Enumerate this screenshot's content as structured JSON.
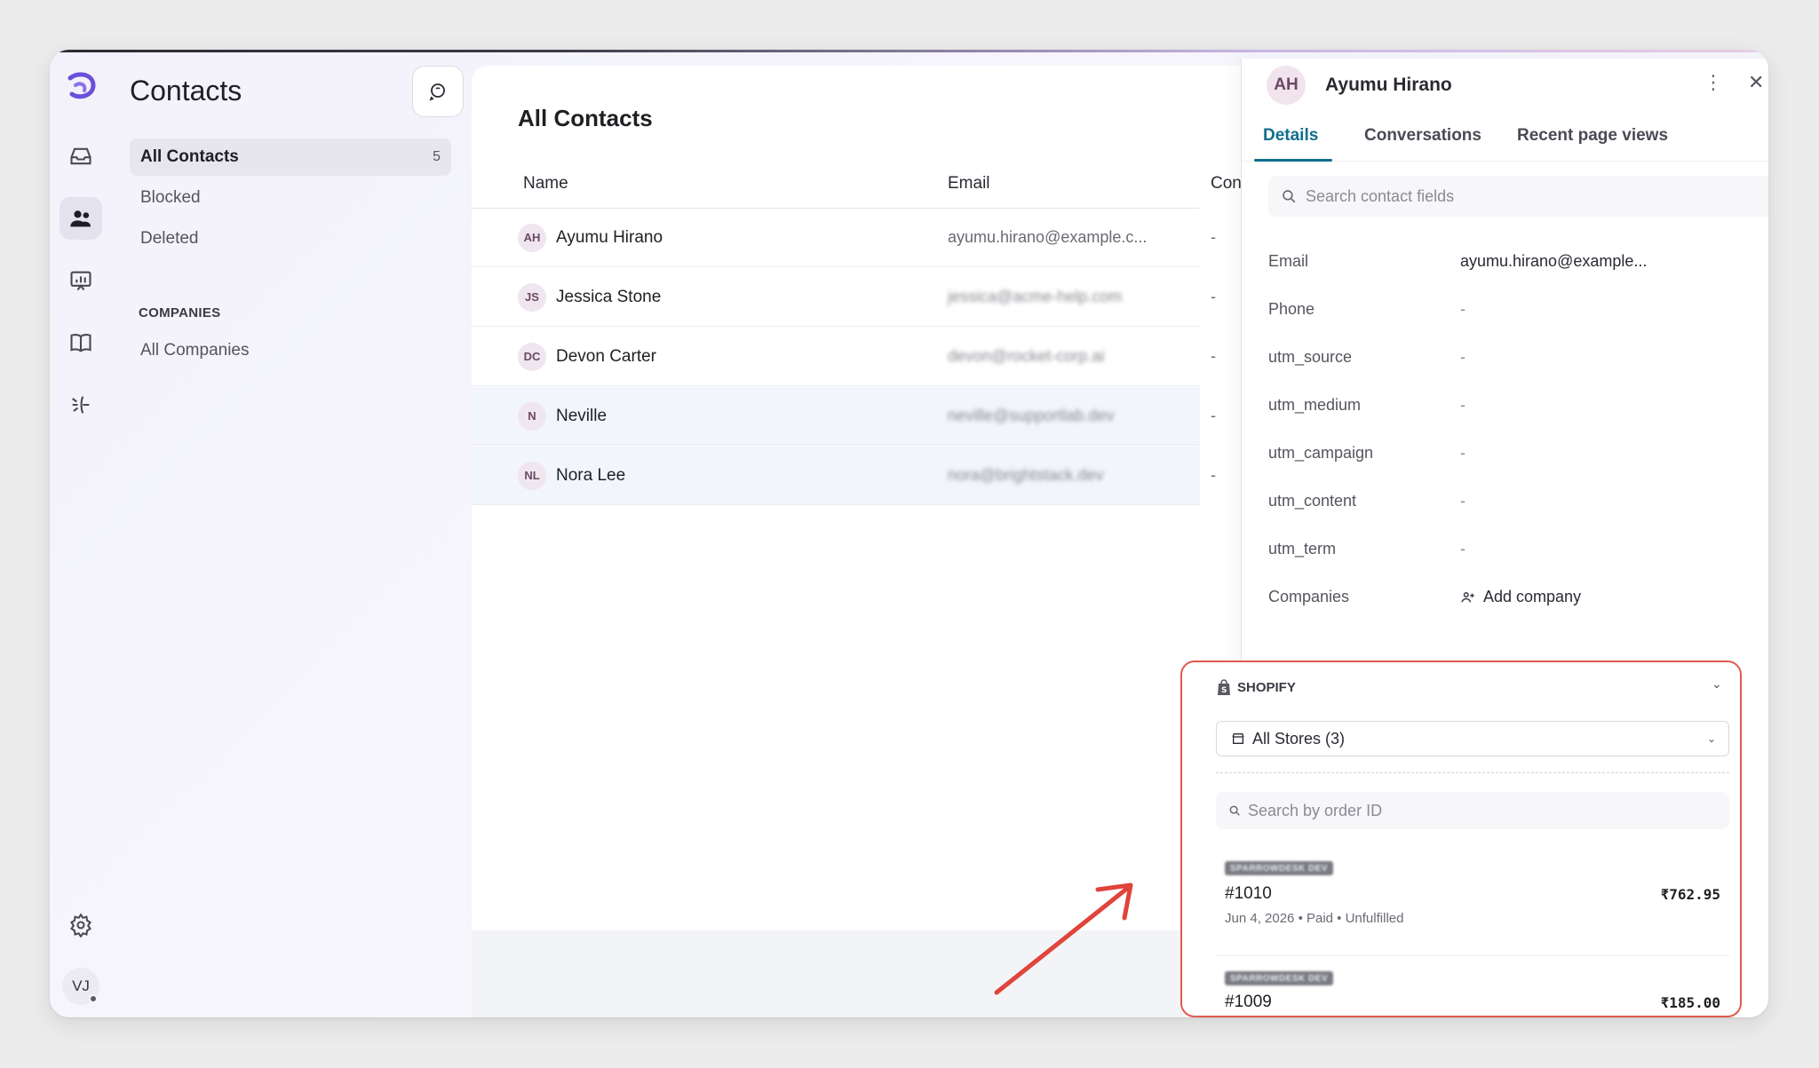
{
  "sidebar_rail": {
    "items": [
      {
        "icon": "inbox-icon"
      },
      {
        "icon": "contacts-icon",
        "active": true
      },
      {
        "icon": "reports-icon"
      },
      {
        "icon": "book-icon"
      },
      {
        "icon": "campaign-icon"
      }
    ],
    "settings_icon": "gear-icon",
    "user_initials": "VJ"
  },
  "contacts_nav": {
    "title": "Contacts",
    "items": [
      {
        "label": "All Contacts",
        "count": "5",
        "active": true
      },
      {
        "label": "Blocked"
      },
      {
        "label": "Deleted"
      }
    ],
    "companies_section": "COMPANIES",
    "companies_items": [
      {
        "label": "All Companies"
      }
    ]
  },
  "contacts_list": {
    "title": "All Contacts",
    "columns": [
      "Name",
      "Email",
      "Con"
    ],
    "rows": [
      {
        "initials": "AH",
        "name": "Ayumu Hirano",
        "email": "ayumu.hirano@example.c...",
        "contact": "-",
        "email_blurred": false
      },
      {
        "initials": "JS",
        "name": "Jessica Stone",
        "email": "jessica@acme-help.com",
        "contact": "-",
        "email_blurred": true
      },
      {
        "initials": "DC",
        "name": "Devon Carter",
        "email": "devon@rocket-corp.ai",
        "contact": "-",
        "email_blurred": true
      },
      {
        "initials": "N",
        "name": "Neville",
        "email": "neville@supportlab.dev",
        "contact": "-",
        "email_blurred": true
      },
      {
        "initials": "NL",
        "name": "Nora Lee",
        "email": "nora@brightstack.dev",
        "contact": "-",
        "email_blurred": true
      }
    ]
  },
  "contact_detail": {
    "initials": "AH",
    "name": "Ayumu Hirano",
    "tabs": [
      "Details",
      "Conversations",
      "Recent page views"
    ],
    "active_tab": "Details",
    "search_placeholder": "Search contact fields",
    "fields": [
      {
        "key": "Email",
        "value": "ayumu.hirano@example..."
      },
      {
        "key": "Phone",
        "value": "-"
      },
      {
        "key": "utm_source",
        "value": "-"
      },
      {
        "key": "utm_medium",
        "value": "-"
      },
      {
        "key": "utm_campaign",
        "value": "-"
      },
      {
        "key": "utm_content",
        "value": "-"
      },
      {
        "key": "utm_term",
        "value": "-"
      },
      {
        "key": "Companies",
        "value": "Add company"
      }
    ]
  },
  "shopify": {
    "header": "SHOPIFY",
    "store_select": "All Stores (3)",
    "order_search_placeholder": "Search by order ID",
    "orders": [
      {
        "store": "SPARROWDESK DEV",
        "id": "#1010",
        "amount": "₹762.95",
        "meta": "Jun 4, 2026 • Paid • Unfulfilled"
      },
      {
        "store": "SPARROWDESK DEV",
        "id": "#1009",
        "amount": "₹185.00",
        "meta": ""
      }
    ]
  },
  "colors": {
    "accent": "#0f6e8c",
    "highlight_box": "#e05a4f",
    "arrow": "#e0443a"
  }
}
